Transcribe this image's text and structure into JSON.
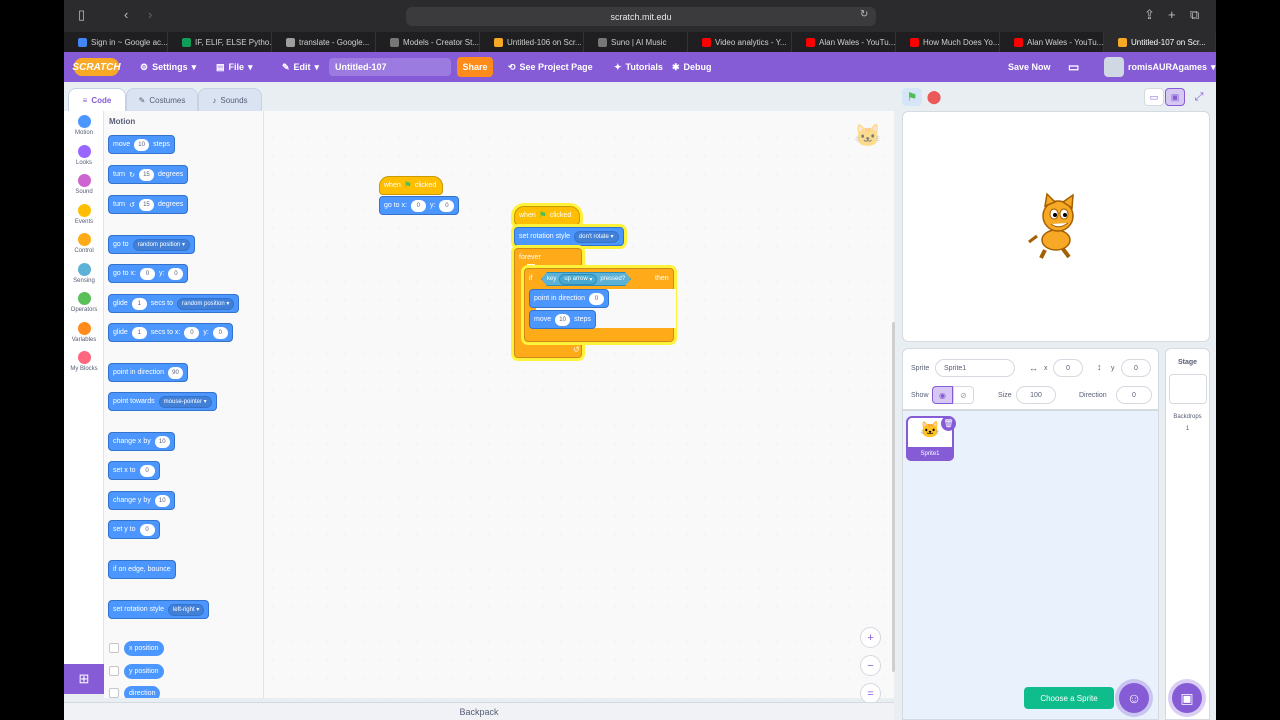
{
  "browser": {
    "url": "scratch.mit.edu",
    "tabs": [
      {
        "label": "Sign in ~ Google ac...",
        "color": "#4285f4"
      },
      {
        "label": "IF, ELIF, ELSE Pytho...",
        "color": "#0f9d58"
      },
      {
        "label": "translate - Google...",
        "color": "#9e9e9e"
      },
      {
        "label": "Models - Creator St...",
        "color": "#777777"
      },
      {
        "label": "Untitled-106 on Scr...",
        "color": "#f7a824"
      },
      {
        "label": "Suno | AI Music",
        "color": "#777777"
      },
      {
        "label": "Video analytics - Y...",
        "color": "#ff0000"
      },
      {
        "label": "Alan Wales - YouTu...",
        "color": "#ff0000"
      },
      {
        "label": "How Much Does Yo...",
        "color": "#ff0000"
      },
      {
        "label": "Alan Wales - YouTu...",
        "color": "#ff0000"
      },
      {
        "label": "Untitled-107 on Scr...",
        "color": "#f7a824"
      }
    ]
  },
  "menubar": {
    "logo": "SCRATCH",
    "settings": "Settings",
    "file": "File",
    "edit": "Edit",
    "project_title": "Untitled-107",
    "share": "Share",
    "see_project": "See Project Page",
    "tutorials": "Tutorials",
    "debug": "Debug",
    "save_now": "Save Now",
    "username": "romisAURAgames"
  },
  "editor_tabs": {
    "code": "Code",
    "costumes": "Costumes",
    "sounds": "Sounds"
  },
  "categories": [
    {
      "label": "Motion",
      "color": "#4c97ff"
    },
    {
      "label": "Looks",
      "color": "#9966ff"
    },
    {
      "label": "Sound",
      "color": "#cf63cf"
    },
    {
      "label": "Events",
      "color": "#ffbf00"
    },
    {
      "label": "Control",
      "color": "#ffab19"
    },
    {
      "label": "Sensing",
      "color": "#5cb1d6"
    },
    {
      "label": "Operators",
      "color": "#59c059"
    },
    {
      "label": "Variables",
      "color": "#ff8c1a"
    },
    {
      "label": "My Blocks",
      "color": "#ff6680"
    }
  ],
  "palette": {
    "title": "Motion",
    "move": {
      "a": "move",
      "n": "10",
      "b": "steps"
    },
    "turn_right": {
      "a": "turn",
      "n": "15",
      "b": "degrees"
    },
    "turn_left": {
      "a": "turn",
      "n": "15",
      "b": "degrees"
    },
    "goto_random": {
      "a": "go to",
      "dd": "random position"
    },
    "goto_xy": {
      "a": "go to x:",
      "x": "0",
      "yl": "y:",
      "y": "0"
    },
    "glide_random": {
      "a": "glide",
      "n": "1",
      "b": "secs to",
      "dd": "random position"
    },
    "glide_xy": {
      "a": "glide",
      "n": "1",
      "b": "secs to x:",
      "x": "0",
      "yl": "y:",
      "y": "0"
    },
    "point_dir": {
      "a": "point in direction",
      "n": "90"
    },
    "point_towards": {
      "a": "point towards",
      "dd": "mouse-pointer"
    },
    "change_x": {
      "a": "change x by",
      "n": "10"
    },
    "set_x": {
      "a": "set x to",
      "n": "0"
    },
    "change_y": {
      "a": "change y by",
      "n": "10"
    },
    "set_y": {
      "a": "set y to",
      "n": "0"
    },
    "bounce": {
      "a": "if on edge, bounce"
    },
    "rot_style": {
      "a": "set rotation style",
      "dd": "left-right"
    },
    "x_position": "x position",
    "y_position": "y position",
    "direction": "direction"
  },
  "workspace": {
    "script1": {
      "hat": {
        "a": "when",
        "b": "clicked"
      },
      "goto": {
        "a": "go to x:",
        "x": "0",
        "yl": "y:",
        "y": "0"
      }
    },
    "script2": {
      "hat": {
        "a": "when",
        "b": "clicked"
      },
      "rot": {
        "a": "set rotation style",
        "dd": "don't rotate"
      },
      "forever": "forever",
      "if_label": "if",
      "then": "then",
      "key": {
        "a": "key",
        "dd": "up arrow",
        "b": "pressed?"
      },
      "point": {
        "a": "point in direction",
        "n": "0"
      },
      "move": {
        "a": "move",
        "n": "10",
        "b": "steps"
      }
    },
    "backpack": "Backpack"
  },
  "sprite_info": {
    "sprite_label": "Sprite",
    "sprite_name": "Sprite1",
    "x_label": "x",
    "x": "0",
    "y_label": "y",
    "y": "0",
    "show_label": "Show",
    "size_label": "Size",
    "size": "100",
    "direction_label": "Direction",
    "direction": "0"
  },
  "sprite_list": {
    "thumb_label": "Sprite1",
    "choose": "Choose a Sprite"
  },
  "stage_pane": {
    "title": "Stage",
    "backdrops_label": "Backdrops",
    "backdrops_count": "1"
  }
}
